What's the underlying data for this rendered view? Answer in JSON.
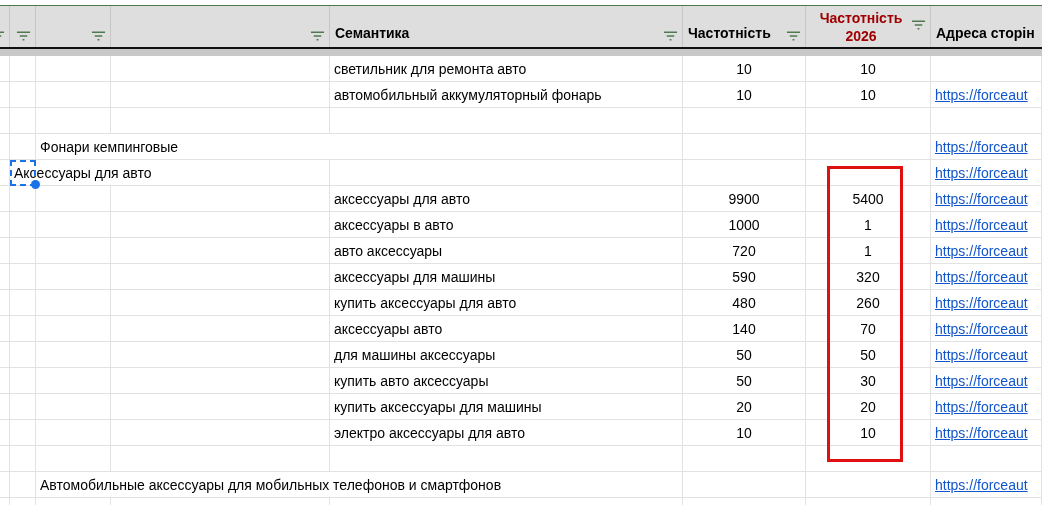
{
  "header": [
    {
      "filter": true
    },
    {
      "filter": true
    },
    {
      "filter": true
    },
    {
      "filter": true
    },
    {
      "label": "Семантика",
      "filter": true,
      "highlighted": false
    },
    {
      "label": "Частотність",
      "filter": true,
      "highlighted": false
    },
    {
      "label": "Частотність 2026",
      "filter": true,
      "highlighted": true
    },
    {
      "label": "Адреса сторін",
      "highlighted": false
    }
  ],
  "rows": [
    {
      "kind": "keyword",
      "selected": false,
      "semantics": "светильник для ремонта авто",
      "frequency": "10",
      "frequency_2026": "10"
    },
    {
      "kind": "keyword",
      "selected": false,
      "semantics": "автомобильный аккумуляторный фонарь",
      "frequency": "10",
      "frequency_2026": "10",
      "url": "https://forceaut"
    },
    {
      "kind": "empty",
      "selected": false
    },
    {
      "kind": "group",
      "selected": false,
      "label": "Фонари кемпинговые",
      "url": "https://forceaut"
    },
    {
      "kind": "category",
      "selected": true,
      "label": "Аксессуары для авто",
      "url": "https://forceaut"
    },
    {
      "kind": "keyword",
      "selected": false,
      "semantics": "аксессуары для авто",
      "frequency": "9900",
      "frequency_2026": "5400",
      "url": "https://forceaut"
    },
    {
      "kind": "keyword",
      "selected": false,
      "semantics": "аксессуары в авто",
      "frequency": "1000",
      "frequency_2026": "1",
      "url": "https://forceaut"
    },
    {
      "kind": "keyword",
      "selected": false,
      "semantics": "авто аксессуары",
      "frequency": "720",
      "frequency_2026": "1",
      "url": "https://forceaut"
    },
    {
      "kind": "keyword",
      "selected": false,
      "semantics": "аксессуары для машины",
      "frequency": "590",
      "frequency_2026": "320",
      "url": "https://forceaut"
    },
    {
      "kind": "keyword",
      "selected": false,
      "semantics": "купить аксессуары для авто",
      "frequency": "480",
      "frequency_2026": "260",
      "url": "https://forceaut"
    },
    {
      "kind": "keyword",
      "selected": false,
      "semantics": "аксессуары авто",
      "frequency": "140",
      "frequency_2026": "70",
      "url": "https://forceaut"
    },
    {
      "kind": "keyword",
      "selected": false,
      "semantics": "для машины аксессуары",
      "frequency": "50",
      "frequency_2026": "50",
      "url": "https://forceaut"
    },
    {
      "kind": "keyword",
      "selected": false,
      "semantics": "купить авто аксессуары",
      "frequency": "50",
      "frequency_2026": "30",
      "url": "https://forceaut"
    },
    {
      "kind": "keyword",
      "selected": false,
      "semantics": "купить аксессуары для машины",
      "frequency": "20",
      "frequency_2026": "20",
      "url": "https://forceaut"
    },
    {
      "kind": "keyword",
      "selected": false,
      "semantics": "электро аксессуары для авто",
      "frequency": "10",
      "frequency_2026": "10",
      "url": "https://forceaut"
    },
    {
      "kind": "empty",
      "selected": false
    },
    {
      "kind": "group",
      "selected": false,
      "label": "Автомобильные аксессуары для мобильных телефонов и смартфонов",
      "url": "https://forceaut"
    }
  ]
}
